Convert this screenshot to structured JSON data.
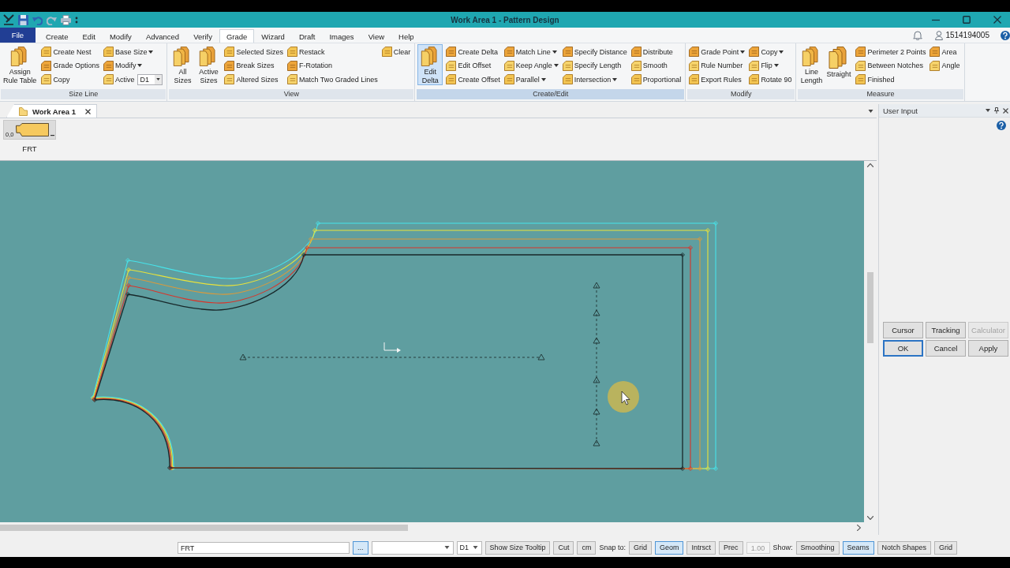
{
  "window": {
    "title": "Work Area 1 - Pattern Design"
  },
  "quick_access": [
    {
      "kind": "logo",
      "disabled": false
    },
    {
      "kind": "save",
      "disabled": false
    },
    {
      "kind": "undo",
      "disabled": false
    },
    {
      "kind": "redo",
      "disabled": true
    },
    {
      "kind": "print",
      "disabled": false
    },
    {
      "kind": "more",
      "disabled": false
    }
  ],
  "menu": {
    "items": [
      {
        "label": "File",
        "kind": "backstage",
        "selected": false
      },
      {
        "label": "Create",
        "kind": "tab",
        "selected": false
      },
      {
        "label": "Edit",
        "kind": "tab",
        "selected": false
      },
      {
        "label": "Modify",
        "kind": "tab",
        "selected": false
      },
      {
        "label": "Advanced",
        "kind": "tab",
        "selected": false
      },
      {
        "label": "Verify",
        "kind": "tab",
        "selected": false
      },
      {
        "label": "Grade",
        "kind": "tab",
        "selected": true
      },
      {
        "label": "Wizard",
        "kind": "tab",
        "selected": false
      },
      {
        "label": "Draft",
        "kind": "tab",
        "selected": false
      },
      {
        "label": "Images",
        "kind": "tab",
        "selected": false
      },
      {
        "label": "View",
        "kind": "tab",
        "selected": false
      },
      {
        "label": "Help",
        "kind": "tab",
        "selected": false
      }
    ],
    "user": "1514194005"
  },
  "ribbon": {
    "groups": [
      {
        "title": "Size Line",
        "active": false,
        "columns": [
          {
            "kind": "large",
            "items": [
              {
                "label": "Assign\nRule Table",
                "selected": false
              }
            ]
          },
          {
            "kind": "small",
            "items": [
              {
                "kind": "button",
                "label": "Create Nest",
                "has_menu": false
              },
              {
                "kind": "button",
                "label": "Grade Options",
                "has_menu": false
              },
              {
                "kind": "button",
                "label": "Copy",
                "has_menu": false
              }
            ]
          },
          {
            "kind": "small",
            "items": [
              {
                "kind": "button",
                "label": "Base Size",
                "has_menu": true
              },
              {
                "kind": "button",
                "label": "Modify",
                "has_menu": true
              },
              {
                "kind": "combo",
                "label": "Active",
                "value": "D1"
              }
            ]
          }
        ]
      },
      {
        "title": "View",
        "active": false,
        "columns": [
          {
            "kind": "large",
            "items": [
              {
                "label": "All\nSizes",
                "selected": false
              },
              {
                "label": "Active\nSizes",
                "selected": false
              }
            ]
          },
          {
            "kind": "small",
            "items": [
              {
                "kind": "button",
                "label": "Selected Sizes",
                "has_menu": false
              },
              {
                "kind": "button",
                "label": "Break Sizes",
                "has_menu": false
              },
              {
                "kind": "button",
                "label": "Altered Sizes",
                "has_menu": false
              }
            ]
          },
          {
            "kind": "small",
            "items": [
              {
                "kind": "button",
                "label": "Restack",
                "has_menu": false
              },
              {
                "kind": "button",
                "label": "F-Rotation",
                "has_menu": false
              },
              {
                "kind": "button",
                "label": "Match Two Graded Lines",
                "has_menu": false
              }
            ]
          },
          {
            "kind": "small",
            "items": [
              {
                "kind": "button",
                "label": "Clear",
                "has_menu": false
              }
            ]
          }
        ]
      },
      {
        "title": "Create/Edit",
        "active": true,
        "columns": [
          {
            "kind": "large",
            "items": [
              {
                "label": "Edit\nDelta",
                "selected": true
              }
            ]
          },
          {
            "kind": "small",
            "items": [
              {
                "kind": "button",
                "label": "Create Delta",
                "has_menu": false
              },
              {
                "kind": "button",
                "label": "Edit Offset",
                "has_menu": false
              },
              {
                "kind": "button",
                "label": "Create Offset",
                "has_menu": false
              }
            ]
          },
          {
            "kind": "small",
            "items": [
              {
                "kind": "button",
                "label": "Match Line",
                "has_menu": true
              },
              {
                "kind": "button",
                "label": "Keep Angle",
                "has_menu": true
              },
              {
                "kind": "button",
                "label": "Parallel",
                "has_menu": true
              }
            ]
          },
          {
            "kind": "small",
            "items": [
              {
                "kind": "button",
                "label": "Specify Distance",
                "has_menu": false
              },
              {
                "kind": "button",
                "label": "Specify Length",
                "has_menu": false
              },
              {
                "kind": "button",
                "label": "Intersection",
                "has_menu": true
              }
            ]
          },
          {
            "kind": "small",
            "items": [
              {
                "kind": "button",
                "label": "Distribute",
                "has_menu": false
              },
              {
                "kind": "button",
                "label": "Smooth",
                "has_menu": false
              },
              {
                "kind": "button",
                "label": "Proportional",
                "has_menu": false
              }
            ]
          }
        ]
      },
      {
        "title": "Modify",
        "active": false,
        "columns": [
          {
            "kind": "small",
            "items": [
              {
                "kind": "button",
                "label": "Grade Point",
                "has_menu": true
              },
              {
                "kind": "button",
                "label": "Rule Number",
                "has_menu": false
              },
              {
                "kind": "button",
                "label": "Export Rules",
                "has_menu": false
              }
            ]
          },
          {
            "kind": "small",
            "items": [
              {
                "kind": "button",
                "label": "Copy",
                "has_menu": true
              },
              {
                "kind": "button",
                "label": "Flip",
                "has_menu": true
              },
              {
                "kind": "button",
                "label": "Rotate 90",
                "has_menu": false
              }
            ]
          }
        ]
      },
      {
        "title": "Measure",
        "active": false,
        "columns": [
          {
            "kind": "large",
            "items": [
              {
                "label": "Line\nLength",
                "selected": false
              },
              {
                "label": "Straight",
                "selected": false
              }
            ]
          },
          {
            "kind": "small",
            "items": [
              {
                "kind": "button",
                "label": "Perimeter 2 Points",
                "has_menu": false
              },
              {
                "kind": "button",
                "label": "Between Notches",
                "has_menu": false
              },
              {
                "kind": "button",
                "label": "Finished",
                "has_menu": false
              }
            ]
          },
          {
            "kind": "small",
            "items": [
              {
                "kind": "button",
                "label": "Area",
                "has_menu": false
              },
              {
                "kind": "button",
                "label": "Angle",
                "has_menu": false
              }
            ]
          }
        ]
      }
    ]
  },
  "documents": {
    "tabs": [
      {
        "label": "Work Area 1",
        "selected": true
      }
    ]
  },
  "pieces": [
    {
      "name": "FRT",
      "origin": "0,0"
    }
  ],
  "user_input": {
    "title": "User Input",
    "rows": [
      {
        "buttons": [
          {
            "label": "Cursor",
            "disabled": false,
            "default": false
          },
          {
            "label": "Tracking",
            "disabled": false,
            "default": false
          },
          {
            "label": "Calculator",
            "disabled": true,
            "default": false
          }
        ]
      },
      {
        "buttons": [
          {
            "label": "OK",
            "disabled": false,
            "default": true
          },
          {
            "label": "Cancel",
            "disabled": false,
            "default": false
          },
          {
            "label": "Apply",
            "disabled": false,
            "default": false
          }
        ]
      }
    ]
  },
  "status_bar": {
    "items": [
      {
        "kind": "field",
        "value": "FRT",
        "disabled": false
      },
      {
        "kind": "button",
        "label": "...",
        "selected": true
      },
      {
        "kind": "combo"
      },
      {
        "kind": "combo",
        "value": "D1"
      },
      {
        "kind": "button",
        "label": "Show Size Tooltip",
        "selected": false
      },
      {
        "kind": "button",
        "label": "Cut",
        "selected": false
      },
      {
        "kind": "button",
        "label": "cm",
        "selected": false
      },
      {
        "kind": "label",
        "label": "Snap to:"
      },
      {
        "kind": "button",
        "label": "Grid",
        "selected": false
      },
      {
        "kind": "button",
        "label": "Geom",
        "selected": true
      },
      {
        "kind": "button",
        "label": "Intrsct",
        "selected": false
      },
      {
        "kind": "button",
        "label": "Prec",
        "selected": false
      },
      {
        "kind": "field",
        "value": "1.00",
        "disabled": true
      },
      {
        "kind": "label",
        "label": "Show:"
      },
      {
        "kind": "button",
        "label": "Smoothing",
        "selected": false
      },
      {
        "kind": "button",
        "label": "Seams",
        "selected": true
      },
      {
        "kind": "button",
        "label": "Notch Shapes",
        "selected": false
      },
      {
        "kind": "button",
        "label": "Grid",
        "selected": false
      }
    ]
  }
}
